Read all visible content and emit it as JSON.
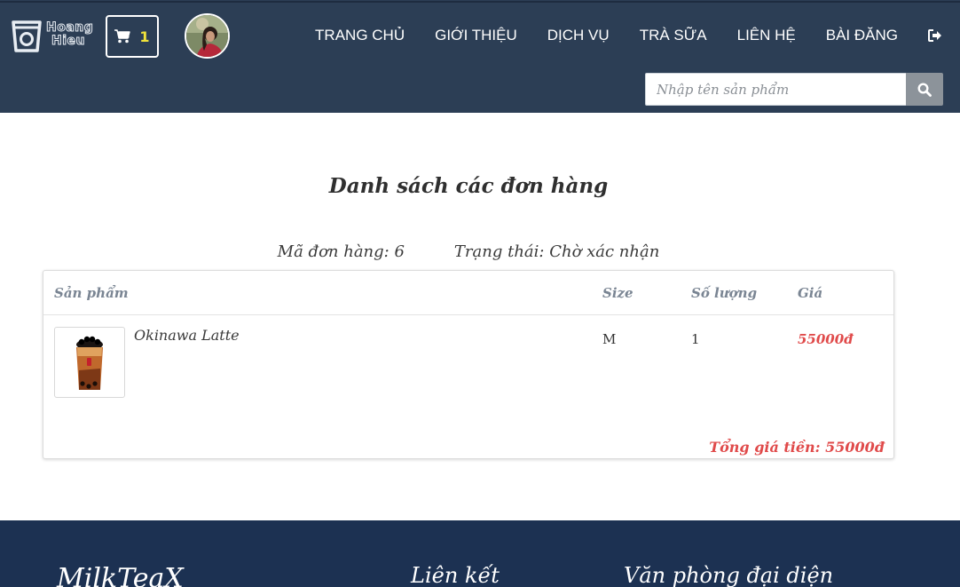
{
  "header": {
    "logo_text_line1": "Hoang",
    "logo_text_line2": "Hieu",
    "cart_count": "1",
    "nav": [
      "TRANG CHỦ",
      "GIỚI THIỆU",
      "DỊCH VỤ",
      "TRÀ SỮA",
      "LIÊN HỆ",
      "BÀI ĐĂNG"
    ],
    "search_placeholder": "Nhập tên sản phẩm"
  },
  "main": {
    "title": "Danh sách các đơn hàng",
    "order_id_label": "Mã đơn hàng: 6",
    "status_label": "Trạng thái: Chờ xác nhận",
    "columns": {
      "product": "Sản phẩm",
      "size": "Size",
      "quantity": "Số lượng",
      "price": "Giá"
    },
    "items": [
      {
        "name": "Okinawa Latte",
        "size": "M",
        "quantity": "1",
        "price": "55000đ"
      }
    ],
    "total": "Tổng giá tiền: 55000đ"
  },
  "footer": {
    "brand": "MilkTeaX",
    "links_title": "Liên kết",
    "office_title": "Văn phòng đại diện"
  },
  "colors": {
    "header_bg": "#2c3e55",
    "footer_bg": "#1c3152",
    "accent_red": "#e04a4a",
    "cart_count": "#f1e33a"
  }
}
